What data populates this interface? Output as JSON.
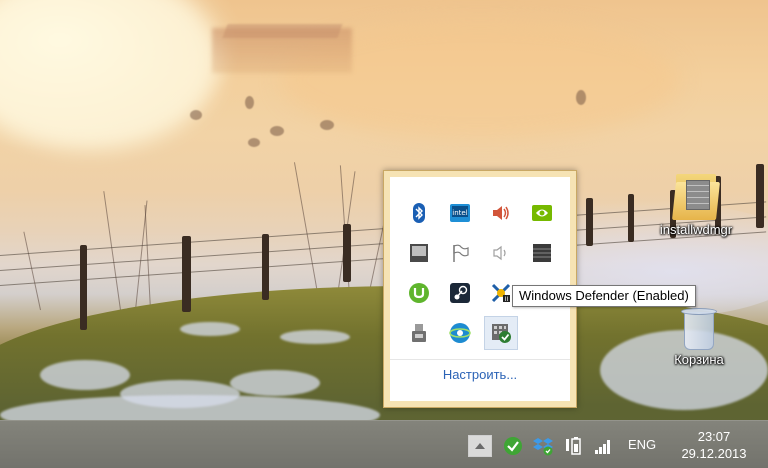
{
  "desktop": {
    "icons": [
      {
        "label": "installwdmgr",
        "icon": "folder-firewall-icon"
      },
      {
        "label": "Корзина",
        "icon": "recycle-bin-icon"
      }
    ]
  },
  "tray_popup": {
    "icons": [
      {
        "name": "bluetooth-icon",
        "color": "#1a5fb4"
      },
      {
        "name": "intel-graphics-icon",
        "color": "#1f8fd6"
      },
      {
        "name": "speaker-icon",
        "color": "#d2553a"
      },
      {
        "name": "nvidia-icon",
        "color": "#76b900"
      },
      {
        "name": "monitor-icon",
        "color": "#4a4a4a"
      },
      {
        "name": "action-center-flag-icon",
        "color": "#8a8a8a"
      },
      {
        "name": "speaker-muted-icon",
        "color": "#a0a0a0"
      },
      {
        "name": "grid-app-icon",
        "color": "#3a3a3a"
      },
      {
        "name": "utorrent-icon",
        "color": "#5fb52d"
      },
      {
        "name": "steam-icon",
        "color": "#1b2838"
      },
      {
        "name": "network-app-icon",
        "color": "#1f5fa8"
      },
      {
        "name": "folder-app-icon",
        "color": "#6a6a6a"
      },
      {
        "name": "usb-safely-remove-icon",
        "color": "#707070"
      },
      {
        "name": "jdownloader-icon",
        "color": "#1d8bd1"
      },
      {
        "name": "windows-defender-icon",
        "color": "#2e7d32",
        "selected": true
      }
    ],
    "customize_label": "Настроить..."
  },
  "tooltip": {
    "text": "Windows Defender (Enabled)"
  },
  "taskbar": {
    "show_hidden_icons": "up-chevron-icon",
    "tray_icons": [
      "green-check-app-icon",
      "dropbox-icon",
      "battery-icon",
      "signal-bars-icon"
    ],
    "language": "ENG",
    "time": "23:07",
    "date": "29.12.2013"
  },
  "colors": {
    "popup_border": "#f6e3b4",
    "link": "#2b63b6",
    "selection": "#e4ecf6"
  }
}
